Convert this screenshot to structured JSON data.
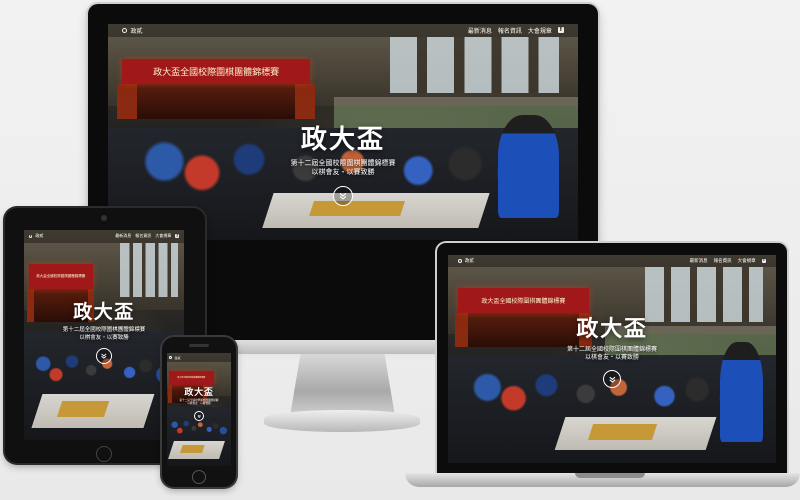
{
  "site": {
    "logo_text": "政貳",
    "nav": [
      "最新消息",
      "報名資訊",
      "大會規章"
    ],
    "facebook_glyph": "f",
    "banner_text": "政大盃全國校際圍棋團體錦標賽",
    "hero_title": "政大盃",
    "hero_subtitle_line1": "第十二屆全國校際圍棋團體錦標賽",
    "hero_subtitle_line2": "以棋會友・以賽致勝"
  },
  "devices": [
    "imac",
    "tablet",
    "laptop",
    "phone"
  ],
  "icons": {
    "logo": "logo-mark-icon",
    "facebook": "facebook-icon",
    "scroll": "chevron-down-icon"
  },
  "colors": {
    "banner": "#a01818",
    "jacket_blue": "#1d4fb8",
    "table_orange": "#d6a33a"
  }
}
